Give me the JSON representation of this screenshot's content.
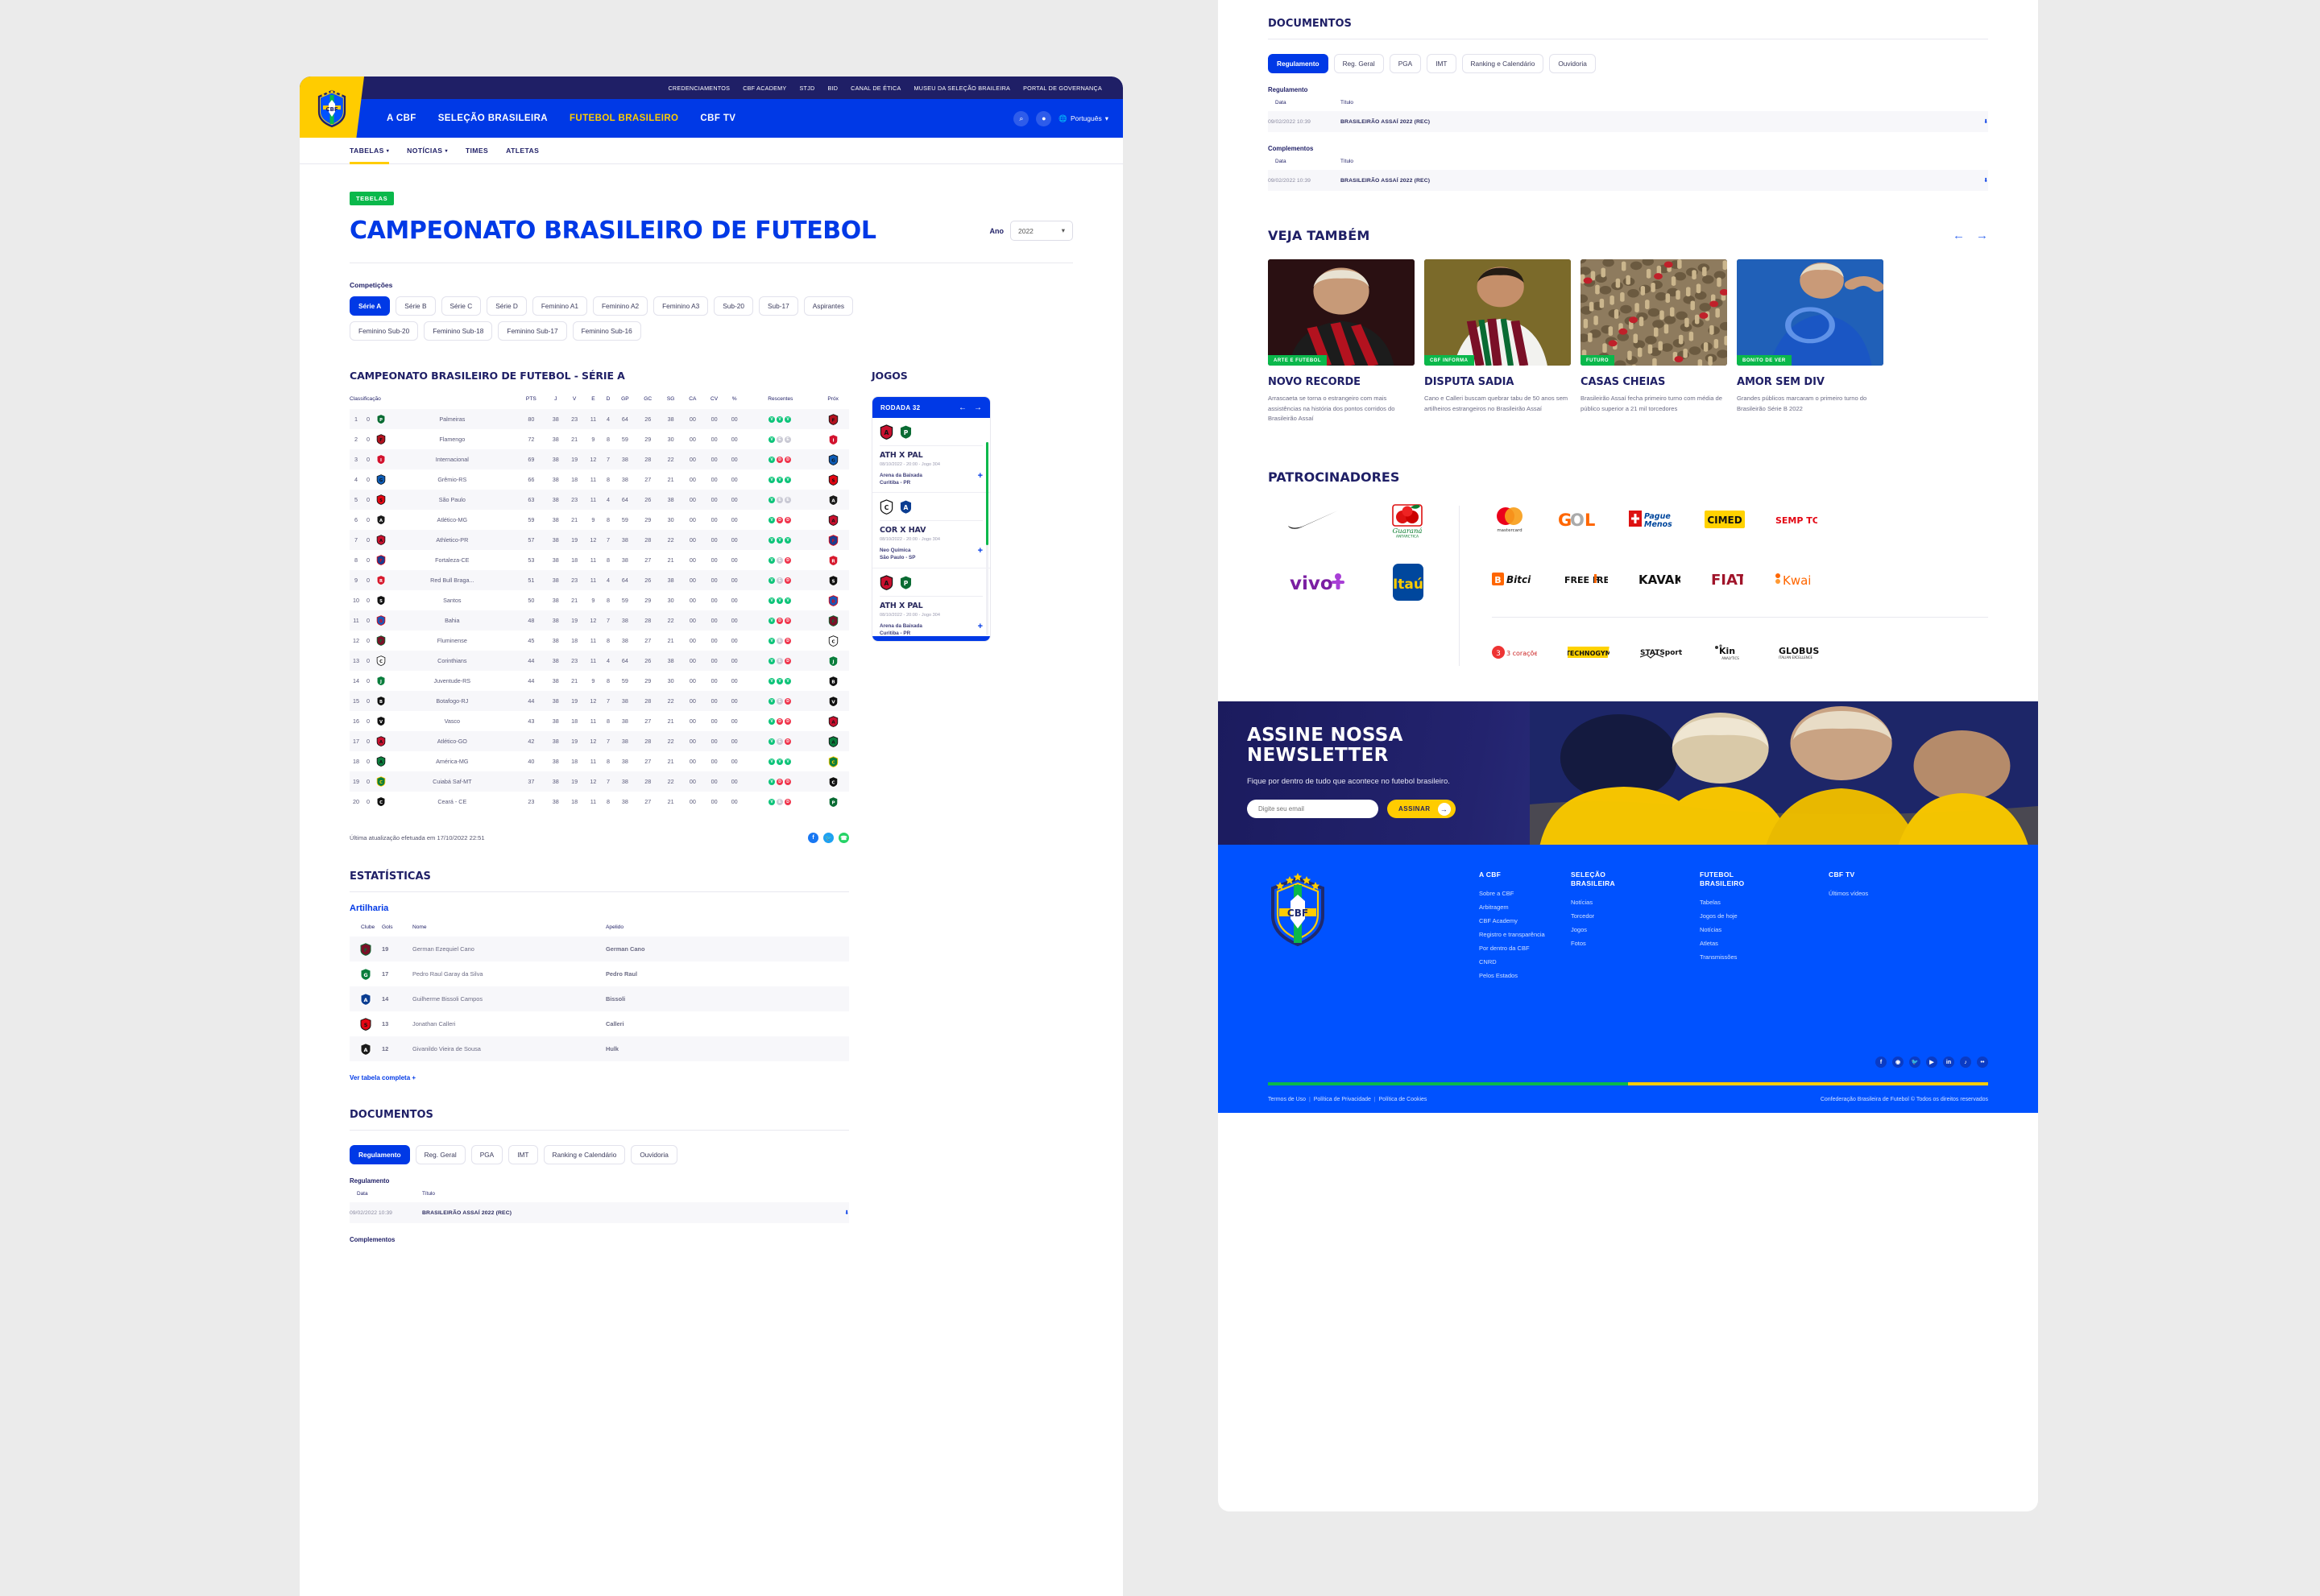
{
  "topbar": {
    "links": [
      "CREDENCIAMENTOS",
      "CBF ACADEMY",
      "STJD",
      "BID",
      "CANAL DE ÉTICA",
      "MUSEU DA SELEÇÃO BRAILEIRA",
      "PORTAL DE GOVERNANÇA"
    ]
  },
  "mainnav": {
    "links": [
      {
        "label": "A CBF",
        "active": false
      },
      {
        "label": "SELEÇÃO BRASILEIRA",
        "active": false
      },
      {
        "label": "FUTEBOL BRASILEIRO",
        "active": true
      },
      {
        "label": "CBF TV",
        "active": false
      }
    ],
    "language": "Português",
    "search_icon": "search-icon",
    "user_icon": "user-icon"
  },
  "subnav": {
    "items": [
      {
        "label": "TABELAS",
        "caret": true,
        "active": true
      },
      {
        "label": "NOTÍCIAS",
        "caret": true,
        "active": false
      },
      {
        "label": "TIMES",
        "caret": false,
        "active": false
      },
      {
        "label": "ATLETAS",
        "caret": false,
        "active": false
      }
    ]
  },
  "hero": {
    "badge": "TEBELAS",
    "title": "CAMPEONATO BRASILEIRO DE FUTEBOL",
    "year_label": "Ano",
    "year_value": "2022"
  },
  "competitions": {
    "label": "Competições",
    "chips": [
      {
        "label": "Série A",
        "active": true
      },
      {
        "label": "Série B",
        "active": false
      },
      {
        "label": "Série C",
        "active": false
      },
      {
        "label": "Série D",
        "active": false
      },
      {
        "label": "Feminino A1",
        "active": false
      },
      {
        "label": "Feminino A2",
        "active": false
      },
      {
        "label": "Feminino A3",
        "active": false
      },
      {
        "label": "Sub-20",
        "active": false
      },
      {
        "label": "Sub-17",
        "active": false
      },
      {
        "label": "Aspirantes",
        "active": false
      },
      {
        "label": "Feminino Sub-20",
        "active": false
      },
      {
        "label": "Feminino Sub-18",
        "active": false
      },
      {
        "label": "Feminino Sub-17",
        "active": false
      },
      {
        "label": "Feminino Sub-16",
        "active": false
      }
    ]
  },
  "standings": {
    "title": "CAMPEONATO BRASILEIRO DE FUTEBOL - SÉRIE A",
    "headers": [
      "Classificação",
      "PTS",
      "J",
      "V",
      "E",
      "D",
      "GP",
      "GC",
      "SG",
      "CA",
      "CV",
      "%",
      "Rescentes",
      "Próx"
    ],
    "rows": [
      {
        "pos": "1",
        "mv": "0",
        "team": "Palmeiras",
        "crest": "palmeiras",
        "pts": "80",
        "j": "38",
        "v": "23",
        "e": "11",
        "d": "4",
        "gp": "64",
        "gc": "26",
        "sg": "38",
        "ca": "00",
        "cv": "00",
        "pct": "00",
        "form": [
          "V",
          "V",
          "V"
        ],
        "next": "flamengo",
        "poscolor": "blue"
      },
      {
        "pos": "2",
        "mv": "0",
        "team": "Flamengo",
        "crest": "flamengo",
        "pts": "72",
        "j": "38",
        "v": "21",
        "e": "9",
        "d": "8",
        "gp": "59",
        "gc": "29",
        "sg": "30",
        "ca": "00",
        "cv": "00",
        "pct": "00",
        "form": [
          "V",
          "E",
          "E"
        ],
        "next": "internacional",
        "poscolor": "blue"
      },
      {
        "pos": "3",
        "mv": "0",
        "team": "Internacional",
        "crest": "internacional",
        "pts": "69",
        "j": "38",
        "v": "19",
        "e": "12",
        "d": "7",
        "gp": "38",
        "gc": "28",
        "sg": "22",
        "ca": "00",
        "cv": "00",
        "pct": "00",
        "form": [
          "V",
          "D",
          "D"
        ],
        "next": "gremio",
        "poscolor": "blue"
      },
      {
        "pos": "4",
        "mv": "0",
        "team": "Grêmio-RS",
        "crest": "gremio",
        "pts": "66",
        "j": "38",
        "v": "18",
        "e": "11",
        "d": "8",
        "gp": "38",
        "gc": "27",
        "sg": "21",
        "ca": "00",
        "cv": "00",
        "pct": "00",
        "form": [
          "V",
          "V",
          "V"
        ],
        "next": "saopaulo",
        "poscolor": "blue"
      },
      {
        "pos": "5",
        "mv": "0",
        "team": "São Paulo",
        "crest": "saopaulo",
        "pts": "63",
        "j": "38",
        "v": "23",
        "e": "11",
        "d": "4",
        "gp": "64",
        "gc": "26",
        "sg": "38",
        "ca": "00",
        "cv": "00",
        "pct": "00",
        "form": [
          "V",
          "E",
          "E"
        ],
        "next": "atleticomg",
        "poscolor": "green"
      },
      {
        "pos": "6",
        "mv": "0",
        "team": "Atlético-MG",
        "crest": "atleticomg",
        "pts": "59",
        "j": "38",
        "v": "21",
        "e": "9",
        "d": "8",
        "gp": "59",
        "gc": "29",
        "sg": "30",
        "ca": "00",
        "cv": "00",
        "pct": "00",
        "form": [
          "V",
          "D",
          "D"
        ],
        "next": "athleticopr",
        "poscolor": "green"
      },
      {
        "pos": "7",
        "mv": "0",
        "team": "Athletico-PR",
        "crest": "athleticopr",
        "pts": "57",
        "j": "38",
        "v": "19",
        "e": "12",
        "d": "7",
        "gp": "38",
        "gc": "28",
        "sg": "22",
        "ca": "00",
        "cv": "00",
        "pct": "00",
        "form": [
          "V",
          "V",
          "V"
        ],
        "next": "fortaleza",
        "poscolor": "green"
      },
      {
        "pos": "8",
        "mv": "0",
        "team": "Fortaleza-CE",
        "crest": "fortaleza",
        "pts": "53",
        "j": "38",
        "v": "18",
        "e": "11",
        "d": "8",
        "gp": "38",
        "gc": "27",
        "sg": "21",
        "ca": "00",
        "cv": "00",
        "pct": "00",
        "form": [
          "V",
          "E",
          "D"
        ],
        "next": "bragantino",
        "poscolor": "blue"
      },
      {
        "pos": "9",
        "mv": "0",
        "team": "Red Bull Braga...",
        "crest": "bragantino",
        "pts": "51",
        "j": "38",
        "v": "23",
        "e": "11",
        "d": "4",
        "gp": "64",
        "gc": "26",
        "sg": "38",
        "ca": "00",
        "cv": "00",
        "pct": "00",
        "form": [
          "V",
          "E",
          "D"
        ],
        "next": "santos",
        "poscolor": "green"
      },
      {
        "pos": "10",
        "mv": "0",
        "team": "Santos",
        "crest": "santos",
        "pts": "50",
        "j": "38",
        "v": "21",
        "e": "9",
        "d": "8",
        "gp": "59",
        "gc": "29",
        "sg": "30",
        "ca": "00",
        "cv": "00",
        "pct": "00",
        "form": [
          "V",
          "V",
          "V"
        ],
        "next": "bahia",
        "poscolor": "green"
      },
      {
        "pos": "11",
        "mv": "0",
        "team": "Bahia",
        "crest": "bahia",
        "pts": "48",
        "j": "38",
        "v": "19",
        "e": "12",
        "d": "7",
        "gp": "38",
        "gc": "28",
        "sg": "22",
        "ca": "00",
        "cv": "00",
        "pct": "00",
        "form": [
          "V",
          "D",
          "D"
        ],
        "next": "fluminense",
        "poscolor": "green"
      },
      {
        "pos": "12",
        "mv": "0",
        "team": "Fluminense",
        "crest": "fluminense",
        "pts": "45",
        "j": "38",
        "v": "18",
        "e": "11",
        "d": "8",
        "gp": "38",
        "gc": "27",
        "sg": "21",
        "ca": "00",
        "cv": "00",
        "pct": "00",
        "form": [
          "V",
          "E",
          "D"
        ],
        "next": "corinthians",
        "poscolor": "green"
      },
      {
        "pos": "13",
        "mv": "0",
        "team": "Corinthians",
        "crest": "corinthians",
        "pts": "44",
        "j": "38",
        "v": "23",
        "e": "11",
        "d": "4",
        "gp": "64",
        "gc": "26",
        "sg": "38",
        "ca": "00",
        "cv": "00",
        "pct": "00",
        "form": [
          "V",
          "E",
          "D"
        ],
        "next": "juventude",
        "poscolor": "green"
      },
      {
        "pos": "14",
        "mv": "0",
        "team": "Juventude-RS",
        "crest": "juventude",
        "pts": "44",
        "j": "38",
        "v": "21",
        "e": "9",
        "d": "8",
        "gp": "59",
        "gc": "29",
        "sg": "30",
        "ca": "00",
        "cv": "00",
        "pct": "00",
        "form": [
          "V",
          "V",
          "V"
        ],
        "next": "botafogo",
        "poscolor": "green"
      },
      {
        "pos": "15",
        "mv": "0",
        "team": "Botafogo-RJ",
        "crest": "botafogo",
        "pts": "44",
        "j": "38",
        "v": "19",
        "e": "12",
        "d": "7",
        "gp": "38",
        "gc": "28",
        "sg": "22",
        "ca": "00",
        "cv": "00",
        "pct": "00",
        "form": [
          "V",
          "E",
          "D"
        ],
        "next": "vasco",
        "poscolor": "dark"
      },
      {
        "pos": "16",
        "mv": "0",
        "team": "Vasco",
        "crest": "vasco",
        "pts": "43",
        "j": "38",
        "v": "18",
        "e": "11",
        "d": "8",
        "gp": "38",
        "gc": "27",
        "sg": "21",
        "ca": "00",
        "cv": "00",
        "pct": "00",
        "form": [
          "V",
          "D",
          "D"
        ],
        "next": "atleticogo",
        "poscolor": "dark"
      },
      {
        "pos": "17",
        "mv": "0",
        "team": "Atlético-GO",
        "crest": "atleticogo",
        "pts": "42",
        "j": "38",
        "v": "19",
        "e": "12",
        "d": "7",
        "gp": "38",
        "gc": "28",
        "sg": "22",
        "ca": "00",
        "cv": "00",
        "pct": "00",
        "form": [
          "V",
          "E",
          "D"
        ],
        "next": "americamg",
        "poscolor": "red"
      },
      {
        "pos": "18",
        "mv": "0",
        "team": "América-MG",
        "crest": "americamg",
        "pts": "40",
        "j": "38",
        "v": "18",
        "e": "11",
        "d": "8",
        "gp": "38",
        "gc": "27",
        "sg": "21",
        "ca": "00",
        "cv": "00",
        "pct": "00",
        "form": [
          "V",
          "V",
          "V"
        ],
        "next": "cuiaba",
        "poscolor": "red"
      },
      {
        "pos": "19",
        "mv": "0",
        "team": "Cuiabá Saf-MT",
        "crest": "cuiaba",
        "pts": "37",
        "j": "38",
        "v": "19",
        "e": "12",
        "d": "7",
        "gp": "38",
        "gc": "28",
        "sg": "22",
        "ca": "00",
        "cv": "00",
        "pct": "00",
        "form": [
          "V",
          "D",
          "D"
        ],
        "next": "ceara",
        "poscolor": "red"
      },
      {
        "pos": "20",
        "mv": "0",
        "team": "Ceará - CE",
        "crest": "ceara",
        "pts": "23",
        "j": "38",
        "v": "18",
        "e": "11",
        "d": "8",
        "gp": "38",
        "gc": "27",
        "sg": "21",
        "ca": "00",
        "cv": "00",
        "pct": "00",
        "form": [
          "V",
          "E",
          "D"
        ],
        "next": "palmeiras",
        "poscolor": "red"
      }
    ]
  },
  "jogos": {
    "title": "JOGOS",
    "rodada": "RODADA 32",
    "matches": [
      {
        "home": "athleticopr",
        "away": "palmeiras",
        "title": "ATH X PAL",
        "date": "08/10/2022 - 20:00 - Jogo 304",
        "venue": "Arena da Baixada",
        "city": "Curitiba - PR"
      },
      {
        "home": "corinthians",
        "away": "avai",
        "title": "COR X HAV",
        "date": "08/10/2022 - 20:00 - Jogo 304",
        "venue": "Neo Química",
        "city": "São Paulo - SP"
      },
      {
        "home": "athleticopr",
        "away": "palmeiras",
        "title": "ATH X PAL",
        "date": "08/10/2022 - 20:00 - Jogo 304",
        "venue": "Arena da Baixada",
        "city": "Curitiba - PR"
      },
      {
        "home": "athleticopr",
        "away": "palmeiras",
        "title": "ATH X PAL",
        "date": "",
        "venue": "",
        "city": ""
      }
    ]
  },
  "update": {
    "text": "Última atualização efetuada em 17/10/2022 22:51",
    "socials": [
      "facebook-icon",
      "twitter-icon",
      "whatsapp-icon"
    ]
  },
  "estatisticas": {
    "title": "ESTATÍSTICAS",
    "subtitle": "Artilharia",
    "headers": [
      "Clube",
      "Gols",
      "Nome",
      "Apelido"
    ],
    "rows": [
      {
        "crest": "fluminense",
        "gols": "19",
        "nome": "German Ezequiel Cano",
        "apelido": "German Cano"
      },
      {
        "crest": "goias",
        "gols": "17",
        "nome": "Pedro Raul Garay da Silva",
        "apelido": "Pedro Raul"
      },
      {
        "crest": "avai",
        "gols": "14",
        "nome": "Guilherme Bissoli Campos",
        "apelido": "Bissoli"
      },
      {
        "crest": "saopaulo",
        "gols": "13",
        "nome": "Jonathan Calleri",
        "apelido": "Calleri"
      },
      {
        "crest": "atleticomg",
        "gols": "12",
        "nome": "Givanildo Vieira de Sousa",
        "apelido": "Hulk"
      }
    ],
    "ver_tabela": "Ver tabela completa"
  },
  "documentos_left": {
    "title": "DOCUMENTOS",
    "chips": [
      {
        "label": "Regulamento",
        "active": true
      },
      {
        "label": "Reg. Geral",
        "active": false
      },
      {
        "label": "PGA",
        "active": false
      },
      {
        "label": "IMT",
        "active": false
      },
      {
        "label": "Ranking e Calendário",
        "active": false
      },
      {
        "label": "Ouvidoria",
        "active": false
      }
    ],
    "regulamento_label": "Regulamento",
    "complementos_label": "Complementos",
    "headers": [
      "Data",
      "Título"
    ],
    "row": {
      "date": "09/02/2022 10:39",
      "title": "BRASILEIRÃO ASSAÍ 2022 (REC)",
      "download_icon": "download-icon"
    }
  },
  "documentos_right": {
    "title": "DOCUMENTOS",
    "chips": [
      {
        "label": "Regulamento",
        "active": true
      },
      {
        "label": "Reg. Geral",
        "active": false
      },
      {
        "label": "PGA",
        "active": false
      },
      {
        "label": "IMT",
        "active": false
      },
      {
        "label": "Ranking e Calendário",
        "active": false
      },
      {
        "label": "Ouvidoria",
        "active": false
      }
    ],
    "regulamento_label": "Regulamento",
    "complementos_label": "Complementos",
    "headers": [
      "Data",
      "Título"
    ],
    "rows": [
      {
        "date": "09/02/2022 10:39",
        "title": "BRASILEIRÃO ASSAÍ 2022 (REC)"
      },
      {
        "date": "09/02/2022 10:39",
        "title": "BRASILEIRÃO ASSAÍ 2022 (REC)"
      }
    ]
  },
  "veja_tambem": {
    "title": "VEJA TAMBÉM",
    "cards": [
      {
        "tag": "ARTE E FUTEBOL",
        "headline": "NOVO RECORDE",
        "text": "Arrascaeta se torna o estrangeiro com mais assistências na história dos pontos corridos do Brasileirão Assaí",
        "img": "flamengo-player"
      },
      {
        "tag": "CBF INFORMA",
        "headline": "DISPUTA SADIA",
        "text": "Cano e Calleri buscam quebrar tabu de 50 anos sem artilheiros estrangeiros no Brasileirão Assaí",
        "img": "fluminense-player"
      },
      {
        "tag": "FUTURO",
        "headline": "CASAS CHEIAS",
        "text": "Brasileirão Assaí fecha primeiro turno com média de público superior a 21 mil torcedores",
        "img": "crowd"
      },
      {
        "tag": "BONITO DE VER",
        "headline": "AMOR SEM DIV",
        "text": "Grandes públicos marcaram o primeiro turno do Brasileirão Série B 2022",
        "img": "blue-player"
      }
    ]
  },
  "patrocinadores": {
    "title": "PATROCINADORES",
    "primary": [
      "Nike",
      "Guaraná Antarctica",
      "vivo",
      "Itaú"
    ],
    "secondary": [
      "mastercard",
      "GOL",
      "Pague Menos",
      "CIMED",
      "SEMP TCL",
      "Bitci",
      "FREE FIRE",
      "KAVAK",
      "FIAT",
      "Kwai"
    ],
    "tertiary": [
      "3 corações",
      "TECHNOGYM",
      "STATSports",
      "Kin Analytics",
      "GLOBUS"
    ]
  },
  "newsletter": {
    "title_line1": "ASSINE NOSSA",
    "title_line2": "NEWSLETTER",
    "subtitle": "Fique por dentro de tudo que acontece no futebol brasileiro.",
    "input_placeholder": "Digite seu email",
    "button": "ASSINAR"
  },
  "footer": {
    "columns": [
      {
        "heading": "A CBF",
        "links": [
          "Sobre a CBF",
          "Arbitragem",
          "CBF Academy",
          "Registro e transparência",
          "Por dentro da CBF",
          "CNRD",
          "Pelos Estados"
        ]
      },
      {
        "heading": "SELEÇÃO BRASILEIRA",
        "links": [
          "Notícias",
          "Torcedor",
          "Jogos",
          "Fotos"
        ]
      },
      {
        "heading": "FUTEBOL BRASILEIRO",
        "links": [
          "Tabelas",
          "Jogos de hoje",
          "Notícias",
          "Atletas",
          "Transmissões"
        ]
      },
      {
        "heading": "CBF TV",
        "links": [
          "Últimos vídeos"
        ]
      }
    ],
    "socials": [
      "facebook-icon",
      "instagram-icon",
      "twitter-icon",
      "youtube-icon",
      "linkedin-icon",
      "tiktok-icon",
      "flickr-icon"
    ],
    "legal": [
      "Termos de Uso",
      "Política de Privacidade",
      "Política de Cookies"
    ],
    "copyright": "Confederação Brasileira de Futebol © Todos os direitos reservados"
  }
}
